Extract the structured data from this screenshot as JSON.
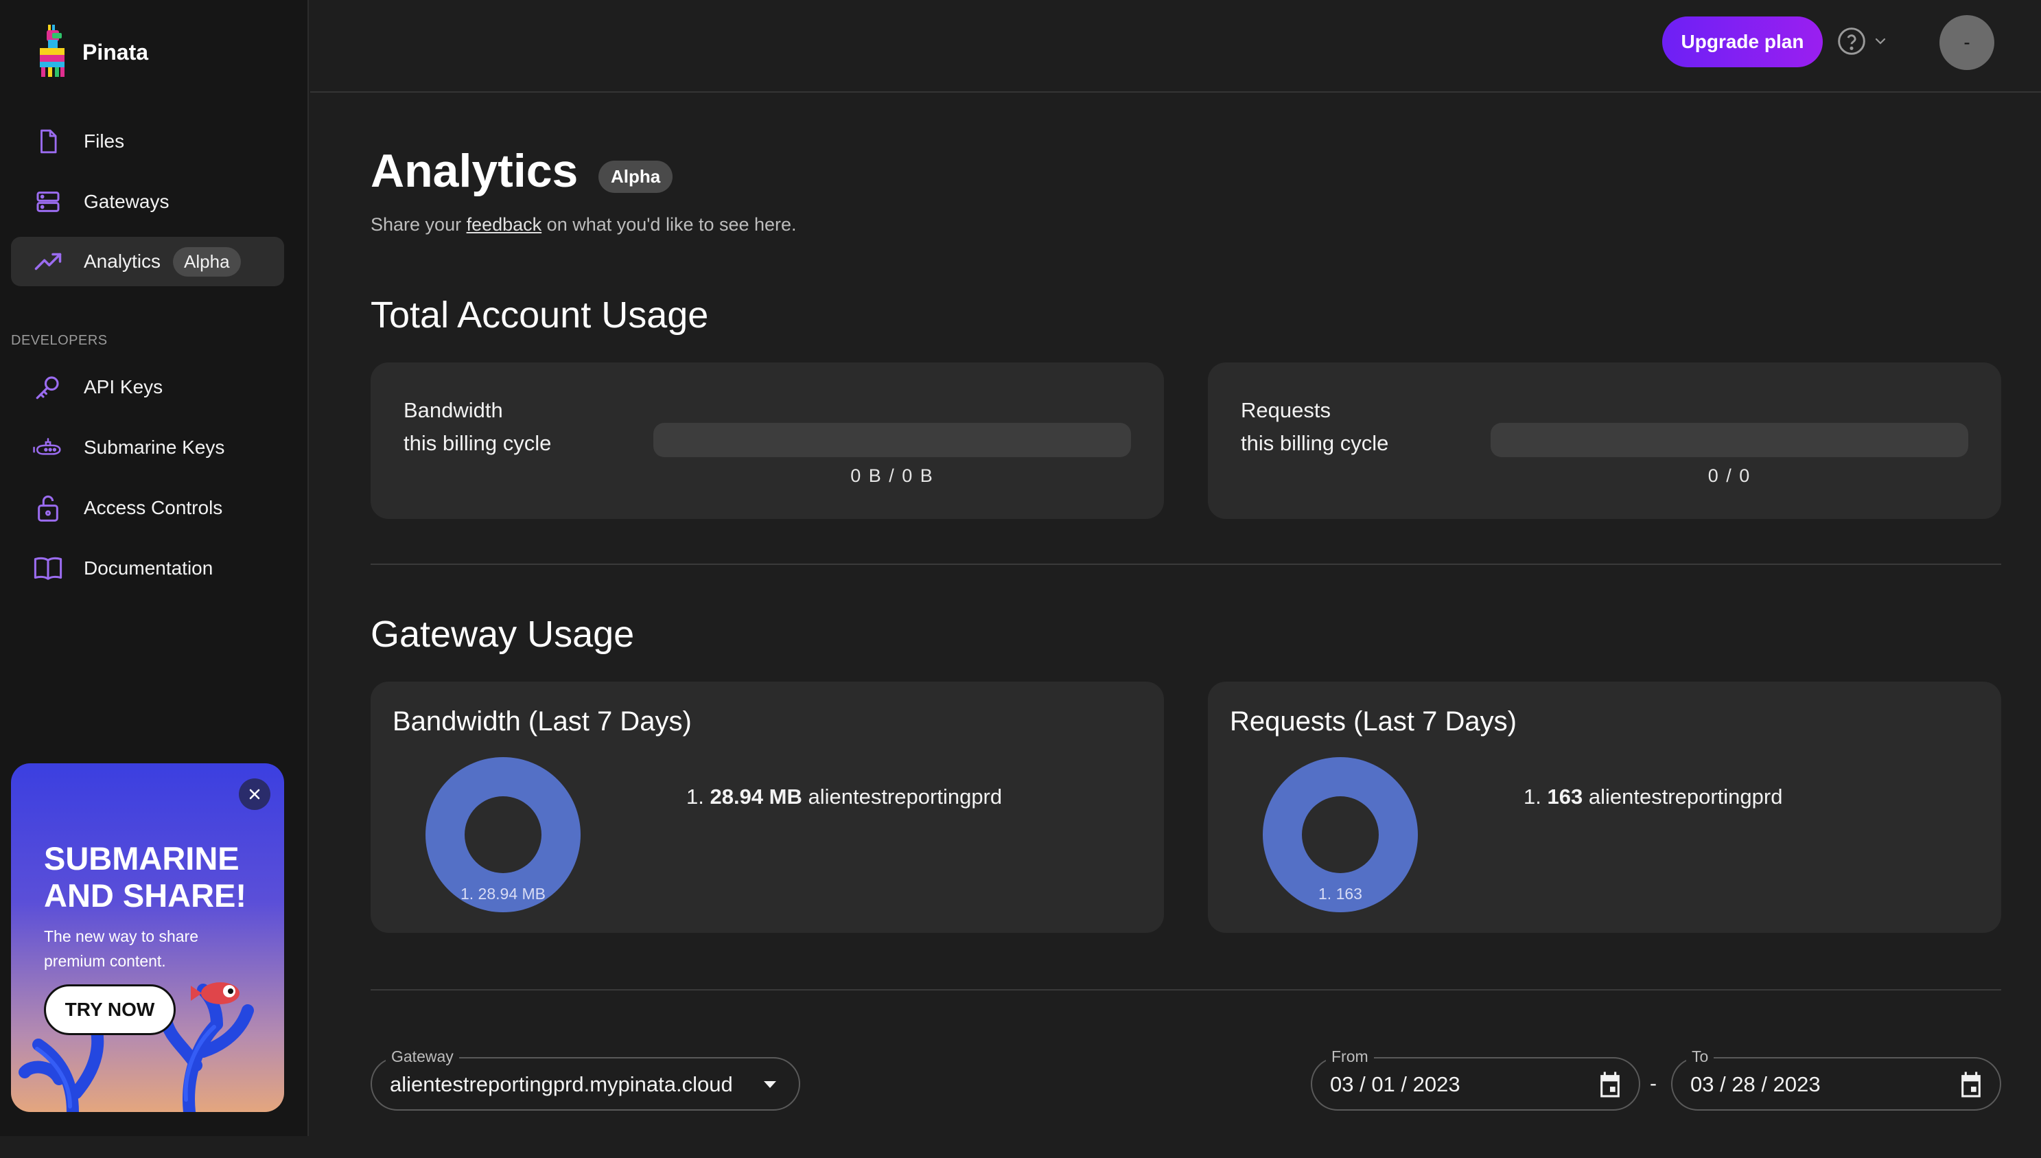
{
  "app": {
    "name": "Pinata"
  },
  "sidebar": {
    "items": [
      {
        "label": "Files",
        "icon": "file-icon"
      },
      {
        "label": "Gateways",
        "icon": "server-icon"
      },
      {
        "label": "Analytics",
        "icon": "trending-up-icon",
        "badge": "Alpha",
        "active": true
      }
    ],
    "section_label": "DEVELOPERS",
    "dev_items": [
      {
        "label": "API Keys",
        "icon": "key-icon"
      },
      {
        "label": "Submarine Keys",
        "icon": "submarine-icon"
      },
      {
        "label": "Access Controls",
        "icon": "lock-icon"
      },
      {
        "label": "Documentation",
        "icon": "book-icon"
      }
    ],
    "promo": {
      "title": "SUBMARINE AND SHARE!",
      "subtitle": "The new way to share premium content.",
      "button": "TRY NOW"
    }
  },
  "topbar": {
    "upgrade": "Upgrade plan",
    "avatar": "-"
  },
  "page": {
    "title": "Analytics",
    "badge": "Alpha",
    "subtitle_prefix": "Share your ",
    "subtitle_link": "feedback",
    "subtitle_suffix": " on what you'd like to see here."
  },
  "total_usage": {
    "heading": "Total Account Usage",
    "bandwidth": {
      "label_1": "Bandwidth",
      "label_2": "this billing cycle",
      "value": "0 B / 0 B",
      "progress": 0
    },
    "requests": {
      "label_1": "Requests",
      "label_2": "this billing cycle",
      "value": "0 / 0",
      "progress": 0
    }
  },
  "gateway_usage": {
    "heading": "Gateway Usage",
    "bandwidth": {
      "title": "Bandwidth (Last 7 Days)",
      "donut_label": "1. 28.94 MB",
      "rank": "1. ",
      "value": "28.94 MB",
      "name": "alientestreportingprd"
    },
    "requests": {
      "title": "Requests (Last 7 Days)",
      "donut_label": "1. 163",
      "rank": "1. ",
      "value": "163",
      "name": "alientestreportingprd"
    }
  },
  "chart_data": [
    {
      "type": "pie",
      "title": "Bandwidth (Last 7 Days)",
      "categories": [
        "alientestreportingprd"
      ],
      "values": [
        28.94
      ],
      "unit": "MB"
    },
    {
      "type": "pie",
      "title": "Requests (Last 7 Days)",
      "categories": [
        "alientestreportingprd"
      ],
      "values": [
        163
      ]
    }
  ],
  "filters": {
    "gateway_label": "Gateway",
    "gateway_value": "alientestreportingprd.mypinata.cloud",
    "from_label": "From",
    "from_value": "03 / 01 / 2023",
    "to_label": "To",
    "to_value": "03 / 28 / 2023",
    "separator": "-"
  },
  "colors": {
    "accent": "#7b3fe4",
    "donut": "#5470c6",
    "background": "#1e1e1e",
    "card": "#2b2b2b"
  }
}
